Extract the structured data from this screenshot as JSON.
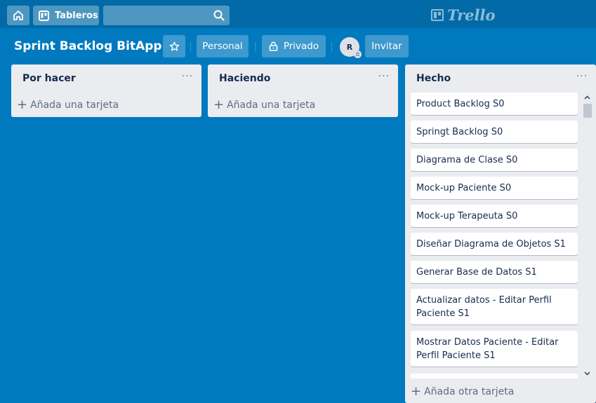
{
  "header": {
    "home_icon": "home-icon",
    "boards_icon": "boards-icon",
    "boards_label": "Tableros",
    "search_icon": "search-icon",
    "logo_text": "Trello"
  },
  "board": {
    "title": "Sprint Backlog BitApp",
    "star_icon": "star-icon",
    "team_label": "Personal",
    "visibility_icon": "lock-icon",
    "visibility_label": "Privado",
    "avatar_initial": "R",
    "invite_label": "Invitar"
  },
  "lists": [
    {
      "title": "Por hacer",
      "menu": "···",
      "add_label": "Añada una tarjeta",
      "cards": []
    },
    {
      "title": "Haciendo",
      "menu": "···",
      "add_label": "Añada una tarjeta",
      "cards": []
    },
    {
      "title": "Hecho",
      "menu": "···",
      "add_label": "Añada otra tarjeta",
      "cards": [
        "Product Backlog S0",
        "Springt Backlog S0",
        "Diagrama de Clase S0",
        "Mock-up Paciente S0",
        "Mock-up Terapeuta S0",
        "Diseñar Diagrama de Objetos S1",
        "Generar Base de Datos S1",
        "Actualizar datos - Editar Perfil Paciente S1",
        "Mostrar Datos Paciente - Editar Perfil Paciente S1",
        ""
      ]
    }
  ],
  "colors": {
    "board_bg": "#0079bf",
    "header_bg": "#026aa7",
    "list_bg": "#ebecf0"
  }
}
